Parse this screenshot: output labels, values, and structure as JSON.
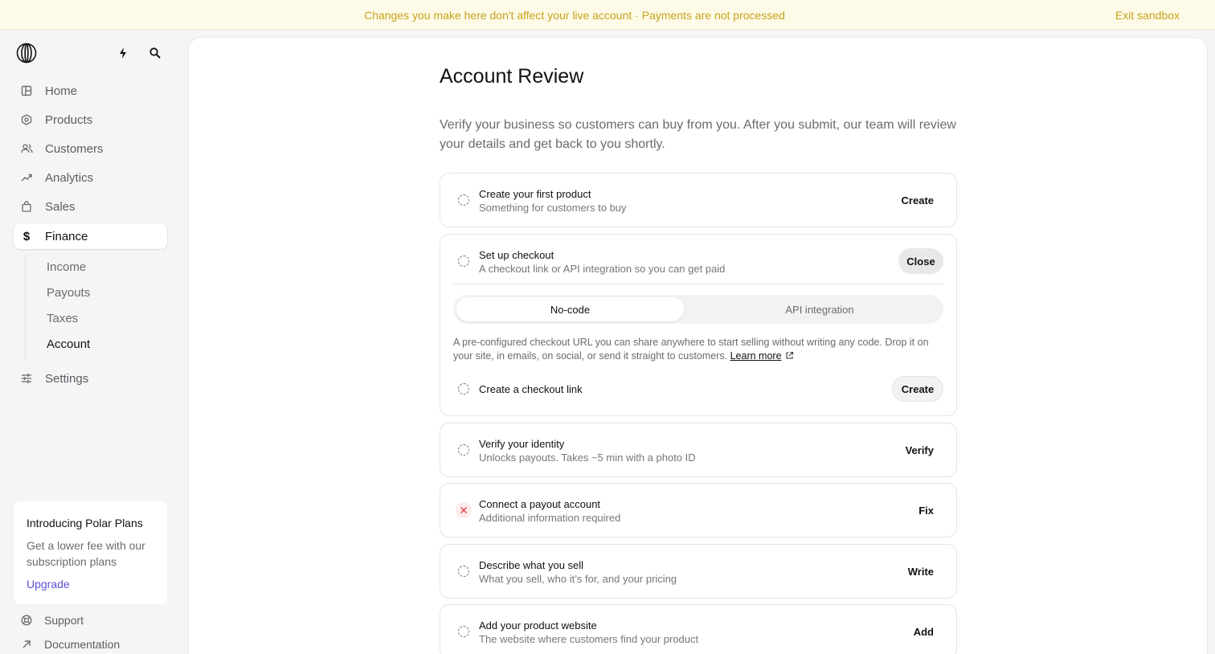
{
  "banner": {
    "message": "Changes you make here don't affect your live account · Payments are not processed",
    "exit_label": "Exit sandbox",
    "color": "#c7a21b"
  },
  "sidebar": {
    "nav": [
      {
        "label": "Home",
        "icon": "home-icon"
      },
      {
        "label": "Products",
        "icon": "products-icon"
      },
      {
        "label": "Customers",
        "icon": "customers-icon"
      },
      {
        "label": "Analytics",
        "icon": "analytics-icon"
      },
      {
        "label": "Sales",
        "icon": "sales-icon"
      },
      {
        "label": "Finance",
        "icon": "dollar-icon",
        "active": true
      }
    ],
    "finance_sub": [
      "Income",
      "Payouts",
      "Taxes",
      "Account"
    ],
    "settings_label": "Settings",
    "promo": {
      "title": "Introducing Polar Plans",
      "text": "Get a lower fee with our subscription plans",
      "link": "Upgrade"
    },
    "footer": {
      "support": "Support",
      "documentation": "Documentation"
    }
  },
  "main": {
    "title": "Account Review",
    "description": "Verify your business so customers can buy from you. After you submit, our team will review your details and get back to you shortly.",
    "steps": [
      {
        "title": "Create your first product",
        "subtitle": "Something for customers to buy",
        "action": "Create",
        "status": "pending"
      },
      {
        "title": "Set up checkout",
        "subtitle": "A checkout link or API integration so you can get paid",
        "action": "Close",
        "status": "pending",
        "expanded": true
      },
      {
        "title": "Verify your identity",
        "subtitle": "Unlocks payouts. Takes ~5 min with a photo ID",
        "action": "Verify",
        "status": "pending"
      },
      {
        "title": "Connect a payout account",
        "subtitle": "Additional information required",
        "action": "Fix",
        "status": "error"
      },
      {
        "title": "Describe what you sell",
        "subtitle": "What you sell, who it’s for, and your pricing",
        "action": "Write",
        "status": "pending"
      },
      {
        "title": "Add your product website",
        "subtitle": "The website where customers find your product",
        "action": "Add",
        "status": "pending"
      }
    ],
    "checkout": {
      "tabs": [
        "No-code",
        "API integration"
      ],
      "active_tab": "No-code",
      "description": "A pre-configured checkout URL you can share anywhere to start selling without writing any code. Drop it on your site, in emails, on social, or send it straight to customers.",
      "learn_more": "Learn more",
      "substep_title": "Create a checkout link",
      "substep_action": "Create"
    }
  }
}
